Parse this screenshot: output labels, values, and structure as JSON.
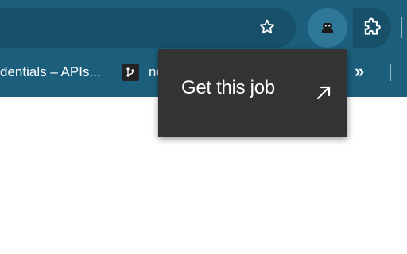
{
  "bookmarks": {
    "items": [
      {
        "label": "dentials – APIs..."
      },
      {
        "label": "ne"
      }
    ],
    "overflow_icon": "chevron-double-right"
  },
  "toolbar": {
    "star_icon": "star-outline",
    "extension_icon": "robot",
    "extensions_icon": "puzzle"
  },
  "popup": {
    "label": "Get this job",
    "icon": "arrow-up-right"
  },
  "colors": {
    "toolbar_bg": "#1c5f7c",
    "omnibox_bg": "#184f69",
    "popup_bg": "#333333",
    "active_ext_bg": "#2e7796"
  }
}
